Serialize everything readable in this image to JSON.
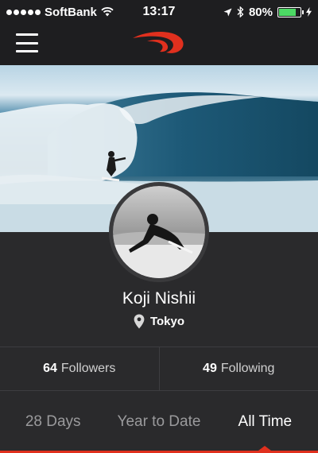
{
  "status_bar": {
    "carrier": "SoftBank",
    "time": "13:17",
    "battery_percent": "80%",
    "battery_level": 0.8
  },
  "nav": {
    "menu_icon": "hamburger-menu-icon",
    "logo_icon": "brand-logo-icon",
    "brand_color": "#e0301e"
  },
  "profile": {
    "name": "Koji Nishii",
    "location": "Tokyo",
    "location_icon": "map-pin-icon"
  },
  "stats": {
    "followers_count": "64",
    "followers_label": "Followers",
    "following_count": "49",
    "following_label": "Following"
  },
  "tabs": [
    {
      "label": "28 Days",
      "active": false
    },
    {
      "label": "Year to Date",
      "active": false
    },
    {
      "label": "All Time",
      "active": true
    }
  ]
}
